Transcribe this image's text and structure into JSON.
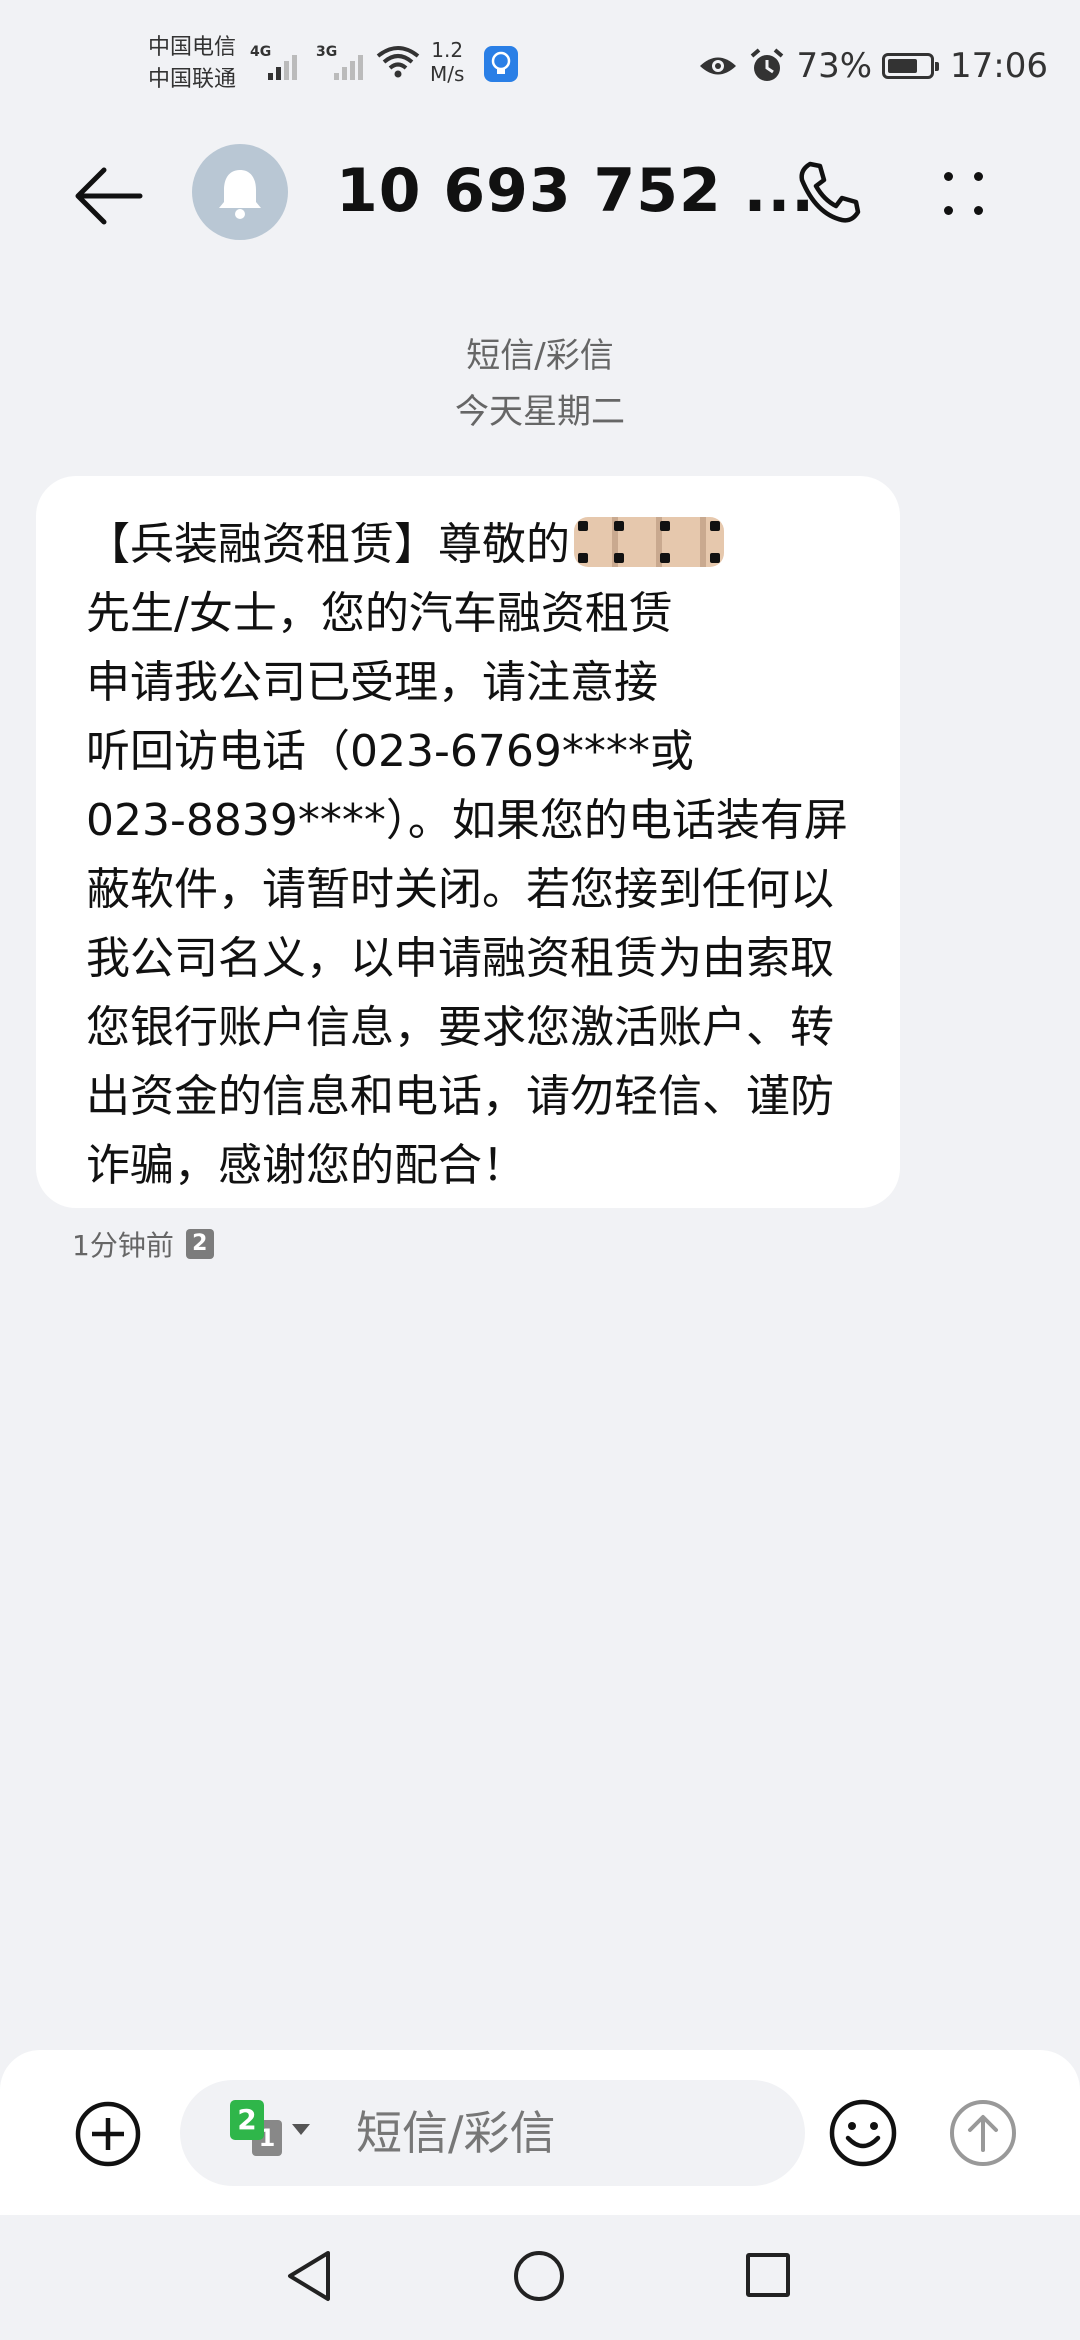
{
  "status_bar": {
    "carrier_1": "中国电信",
    "carrier_2": "中国联通",
    "sim1_network": "4G",
    "sim2_network": "3G",
    "speed_value": "1.2",
    "speed_unit": "M/s",
    "battery_percent": "73%",
    "battery_level": 0.73,
    "time": "17:06"
  },
  "header": {
    "title": "10 693 752 ..."
  },
  "thread": {
    "type_label": "短信/彩信",
    "date_label": "今天星期二"
  },
  "message": {
    "text_before_redaction": "【兵装融资租赁】尊敬的",
    "text_after_redaction": "先生/女士，您的汽车融资租赁\n申请我公司已受理，请注意接\n听回访电话（023-6769****或\n023-8839****）。如果您的电话装有屏蔽软件，请暂时关闭。若您接到任何以我公司名义，以申请融资租赁为由索取您银行账户信息，要求您激活账户、转出资金的信息和电话，请勿轻信、谨防诈骗，感谢您的配合！",
    "time": "1分钟前",
    "sim_number": "2"
  },
  "composer": {
    "sim_primary": "2",
    "sim_secondary": "1",
    "placeholder": "短信/彩信"
  },
  "colors": {
    "background": "#f1f2f5",
    "bubble": "#ffffff",
    "sim2_green": "#2fb64a",
    "avatar": "#b9c7d4",
    "accent_blue": "#2a7fe6"
  },
  "icons": [
    "back-arrow-icon",
    "bell-icon",
    "phone-icon",
    "more-icon",
    "eye-icon",
    "alarm-icon",
    "battery-icon",
    "wifi-icon",
    "add-icon",
    "emoji-icon",
    "send-icon",
    "nav-back-icon",
    "nav-home-icon",
    "nav-recent-icon"
  ]
}
